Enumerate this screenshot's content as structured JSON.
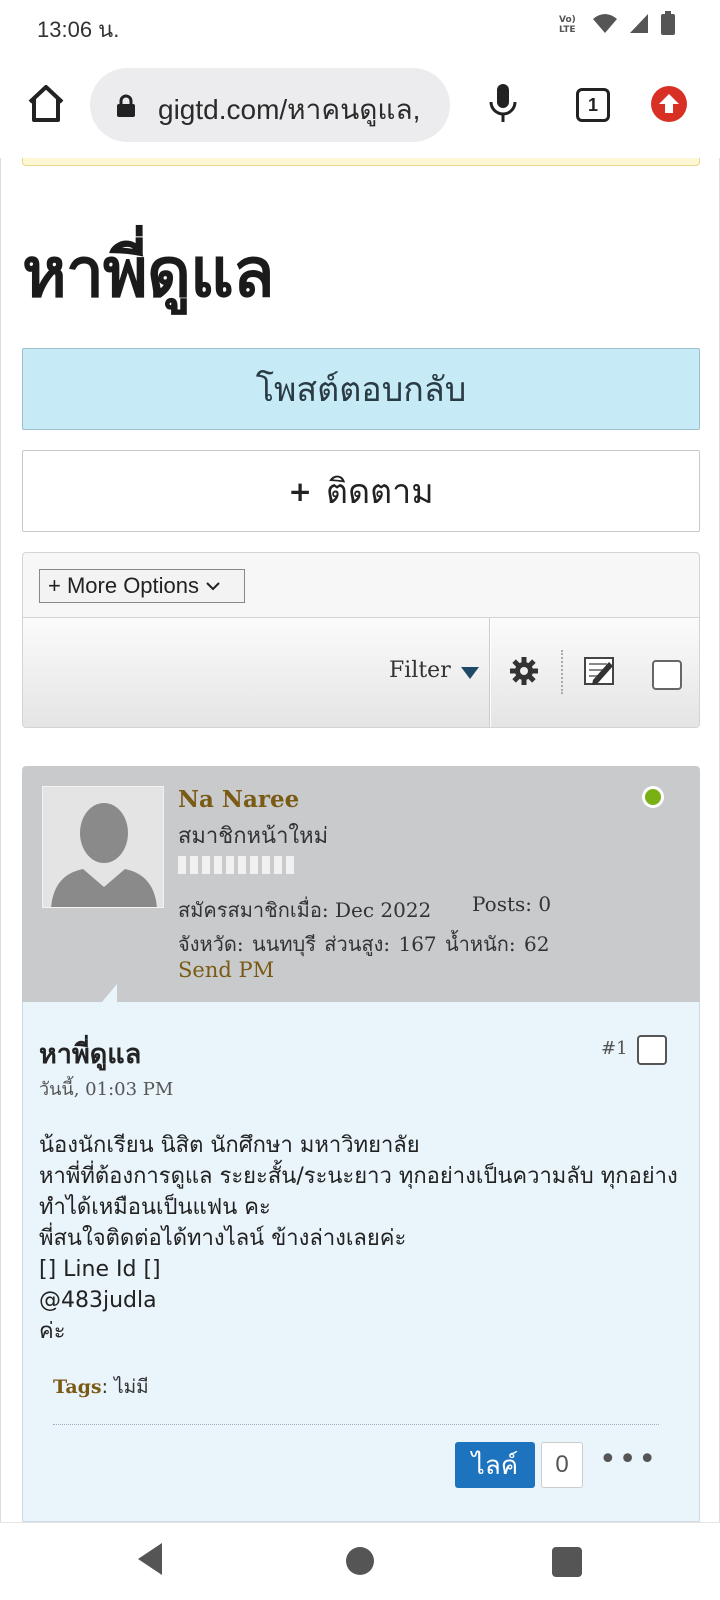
{
  "status_bar": {
    "time": "13:06 น.",
    "icons": [
      "volte-icon",
      "wifi-icon",
      "signal-icon",
      "battery-icon"
    ]
  },
  "browser": {
    "url": "gigtd.com/หาคนดูแล,",
    "tab_count": "1",
    "icons": [
      "home-icon",
      "lock-icon",
      "mic-icon",
      "tabs-icon",
      "update-icon"
    ]
  },
  "thread": {
    "title": "หาพี่ดูแล",
    "reply_label": "โพสต์ตอบกลับ",
    "follow_plus": "+",
    "follow_label": "ติดตาม"
  },
  "options": {
    "more_options_label": "+ More Options",
    "filter_label": "Filter"
  },
  "post": {
    "user": {
      "name": "Na Naree",
      "title": "สมาชิกหน้าใหม่",
      "join": "สมัครสมาชิกเมื่อ: Dec 2022",
      "posts": "Posts: 0",
      "details": "จังหวัด: นนทบุรี    ส่วนสูง: 167    น้ำหนัก: 62",
      "send_pm": "Send PM",
      "online": true
    },
    "title": "หาพี่ดูแล",
    "date": "วันนี้, 01:03 PM",
    "number": "#1",
    "content": [
      "น้องนักเรียน นิสิต นักศึกษา มหาวิทยาลัย",
      "หาพี่ที่ต้องการดูแล ระยะสั้น/ระนะยาว ทุกอย่างเป็นความลับ ทุกอย่างทำได้เหมือนเป็นแฟน คะ",
      "พี่สนใจติดต่อได้ทางไลน์ ข้างล่างเลยค่ะ",
      "[] Line Id []",
      "@483judla",
      "ค่ะ"
    ],
    "tags_label": "Tags",
    "tags_value": "ไม่มี",
    "like_label": "ไลค์",
    "like_count": "0",
    "more_label": "•••"
  },
  "colors": {
    "reply_bg": "#c6eaf6",
    "user_panel_bg": "#c8cacc",
    "post_bg": "#e9f4fb",
    "like_bg": "#1e73be",
    "username_color": "#7a5a14",
    "online_color": "#79b014",
    "update_color": "#d93025"
  }
}
